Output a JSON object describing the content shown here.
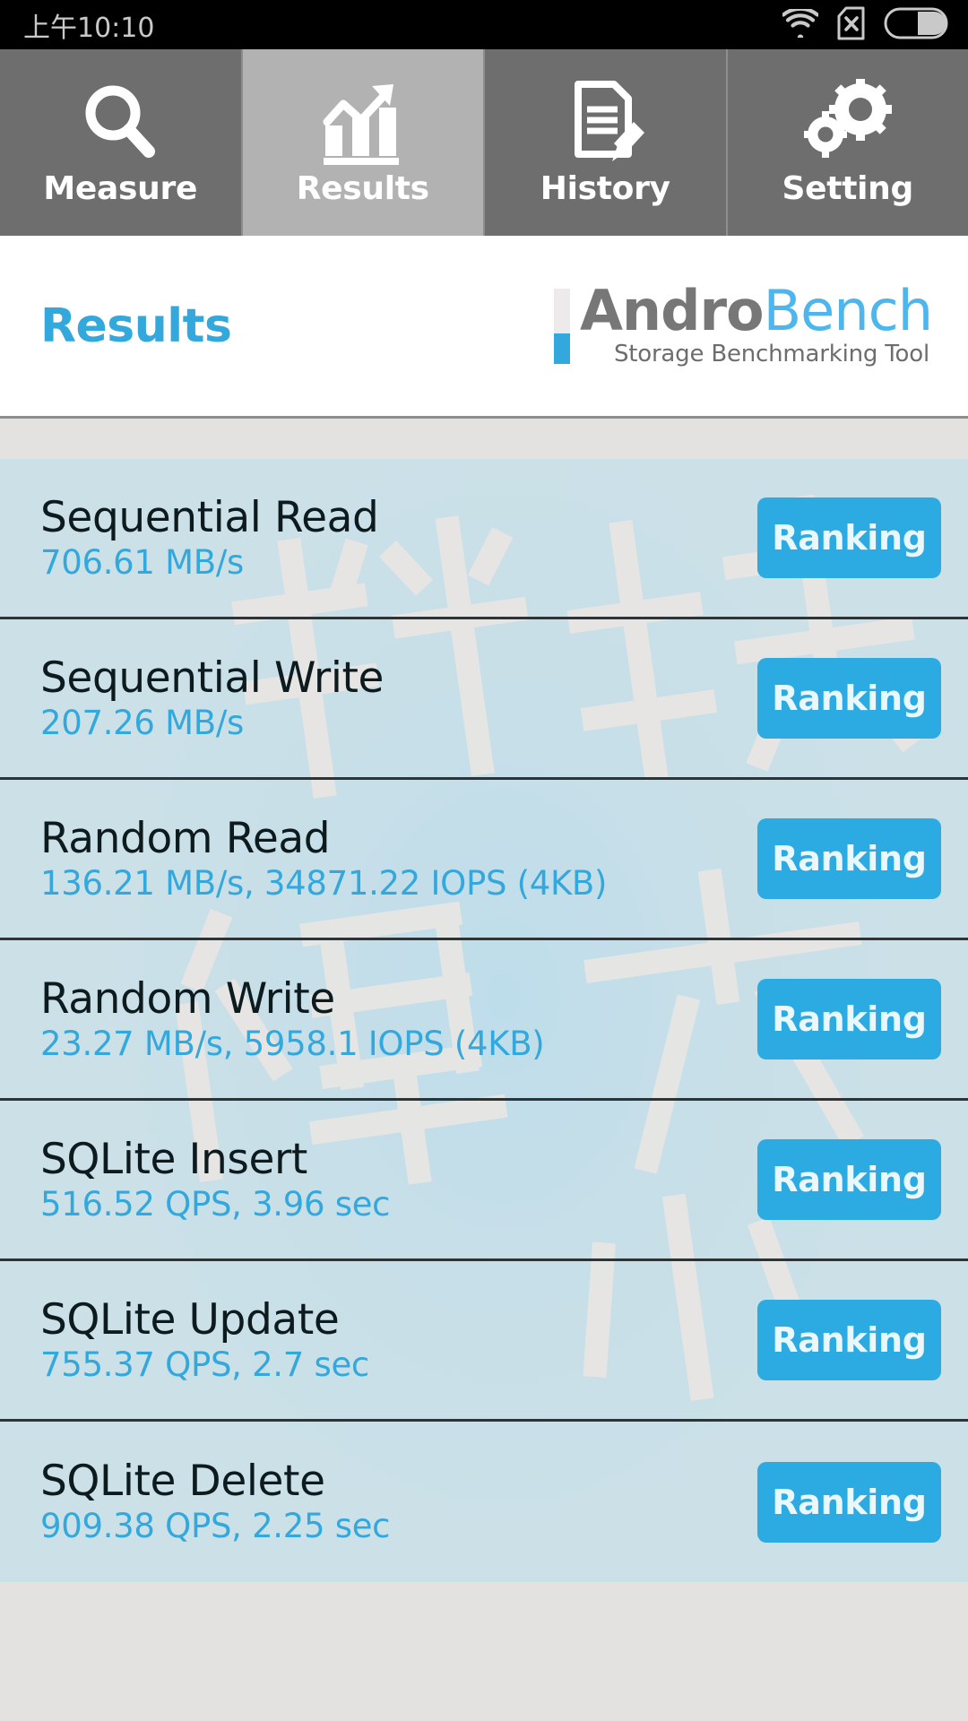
{
  "status_bar": {
    "clock": "上午10:10",
    "icons": [
      {
        "name": "wifi-icon"
      },
      {
        "name": "sim-card-x-icon"
      },
      {
        "name": "battery-icon"
      }
    ]
  },
  "tabs": [
    {
      "label": "Measure",
      "icon": "search-icon",
      "active": false
    },
    {
      "label": "Results",
      "icon": "chart-icon",
      "active": true
    },
    {
      "label": "History",
      "icon": "document-pencil-icon",
      "active": false
    },
    {
      "label": "Setting",
      "icon": "gears-icon",
      "active": false
    }
  ],
  "header": {
    "title": "Results",
    "brand_andro": "Andro",
    "brand_bench": "Bench",
    "tagline": "Storage Benchmarking Tool"
  },
  "results": [
    {
      "name": "Sequential Read",
      "value": "706.61 MB/s",
      "button": "Ranking"
    },
    {
      "name": "Sequential Write",
      "value": "207.26 MB/s",
      "button": "Ranking"
    },
    {
      "name": "Random Read",
      "value": "136.21 MB/s, 34871.22 IOPS (4KB)",
      "button": "Ranking"
    },
    {
      "name": "Random Write",
      "value": "23.27 MB/s, 5958.1 IOPS (4KB)",
      "button": "Ranking"
    },
    {
      "name": "SQLite Insert",
      "value": "516.52 QPS, 3.96 sec",
      "button": "Ranking"
    },
    {
      "name": "SQLite Update",
      "value": "755.37 QPS, 2.7 sec",
      "button": "Ranking"
    },
    {
      "name": "SQLite Delete",
      "value": "909.38 QPS, 2.25 sec",
      "button": "Ranking"
    }
  ],
  "colors": {
    "accent_blue": "#33a8dd",
    "button_blue": "#2cabe3",
    "row_background": "#cce0e7",
    "tab_active": "#b2b2b2",
    "tab_inactive": "#6e6e6e",
    "page_background": "#e4e1e1"
  }
}
